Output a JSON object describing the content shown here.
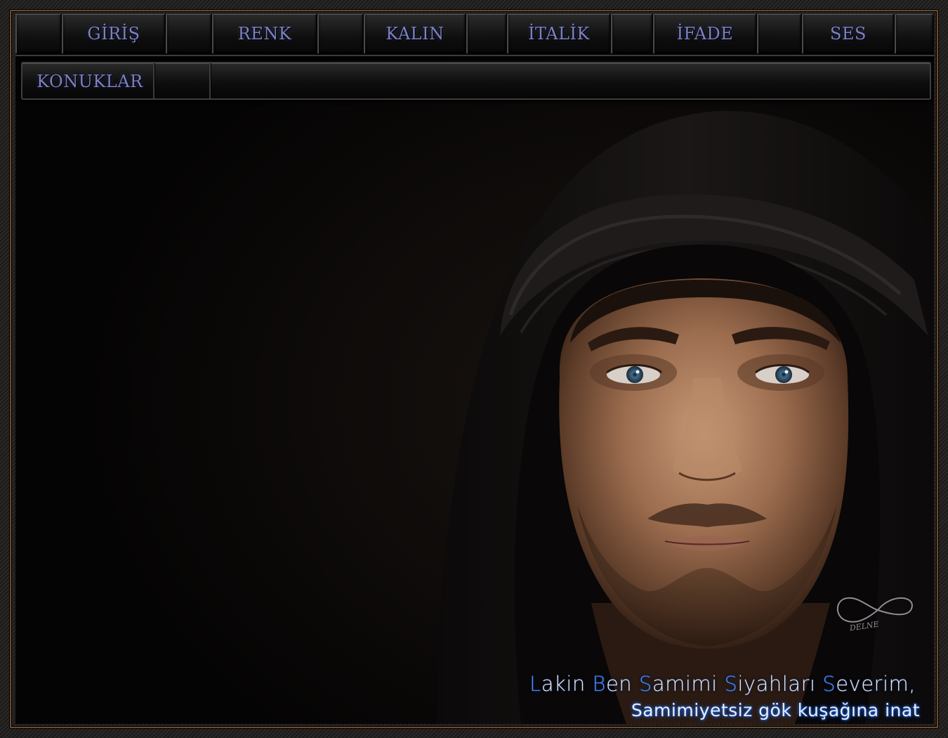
{
  "nav": {
    "items": [
      {
        "label": "GİRİŞ"
      },
      {
        "label": "RENK"
      },
      {
        "label": "KALIN"
      },
      {
        "label": "İTALİK"
      },
      {
        "label": "İFADE"
      },
      {
        "label": "SES"
      }
    ]
  },
  "subnav": {
    "items": [
      {
        "label": "KONUKLAR"
      }
    ]
  },
  "artwork": {
    "signature_text": "DELNE",
    "quote_line1_parts": [
      "L",
      "akin ",
      "B",
      "en ",
      "S",
      "amimi ",
      "S",
      "iyahları ",
      "S",
      "everim,"
    ],
    "quote_line2": "Samimiyetsiz gök kuşağına inat"
  },
  "colors": {
    "nav_text": "#7b82c4",
    "frame_accent": "#6e4a2c",
    "quote_glow": "#1d64d8",
    "background": "#050404"
  }
}
